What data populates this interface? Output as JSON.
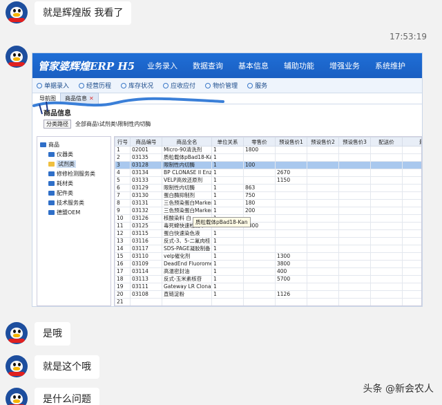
{
  "messages": [
    {
      "text": "就是辉煌版 我看了"
    },
    {
      "text": "是哦"
    },
    {
      "text": "就是这个哦"
    },
    {
      "text": "是什么问题"
    }
  ],
  "timestamp": "17:53:19",
  "erp": {
    "logo": "管家婆辉煌ERP H5",
    "nav": [
      "业务录入",
      "数据查询",
      "基本信息",
      "辅助功能",
      "增强业务",
      "系统维护"
    ],
    "toolbar": [
      "单据录入",
      "经营历程",
      "库存状况",
      "应收应付",
      "物价管理",
      "服务"
    ],
    "tabs": [
      "导航图",
      "商品信息"
    ],
    "page_title": "商品信息",
    "crumb_button": "分类路径",
    "crumb_path": "全部商品\\试剂类\\限制性内切酶",
    "tree": [
      "商品",
      "仪器类",
      "试剂类",
      "修修检测服务类",
      "耗材类",
      "配件类",
      "技术服务类",
      "德盟OEM"
    ],
    "columns": [
      "行号",
      "商品编号",
      "商品全名",
      "单位关系",
      "零售价",
      "预设售价1",
      "预设售价2",
      "预设售价3",
      "配送价",
      "最近"
    ],
    "rows": [
      [
        "1",
        "02001",
        "Micro-90清洗剂",
        "1",
        "1800",
        "",
        ""
      ],
      [
        "2",
        "03135",
        "质粒载体pBad18-Kan",
        "1",
        "",
        "",
        ""
      ],
      [
        "3",
        "03128",
        "限制性内切酶",
        "1",
        "100",
        "",
        ""
      ],
      [
        "4",
        "03134",
        "BP CLONASE II Enz",
        "1",
        "",
        "2670",
        ""
      ],
      [
        "5",
        "03133",
        "VELP高效还原剂",
        "1",
        "",
        "1150",
        ""
      ],
      [
        "6",
        "03129",
        "限制性内切酶",
        "1",
        "863",
        "",
        ""
      ],
      [
        "7",
        "03130",
        "蛋白酶抑制剂",
        "1",
        "750",
        "",
        ""
      ],
      [
        "8",
        "03131",
        "三色预染蛋白Marker",
        "1",
        "180",
        "",
        ""
      ],
      [
        "9",
        "03132",
        "三色预染蛋白Marker",
        "1",
        "200",
        "",
        ""
      ],
      [
        "10",
        "03126",
        "核酸染料  白",
        "1",
        "",
        "",
        ""
      ],
      [
        "11",
        "03125",
        "毒死蜱快速检测卡",
        "1",
        "1800",
        "",
        ""
      ],
      [
        "12",
        "03115",
        "蛋白快速染色液",
        "1",
        "",
        "",
        ""
      ],
      [
        "13",
        "03116",
        "反式-3、5-二氟肉桂",
        "1",
        "",
        "",
        ""
      ],
      [
        "14",
        "03117",
        "SDS-PAGE凝胶制备",
        "1",
        "",
        "",
        ""
      ],
      [
        "15",
        "03110",
        "velp催化剂",
        "1",
        "",
        "1300",
        ""
      ],
      [
        "16",
        "03109",
        "DeadEnd Fluorome",
        "1",
        "",
        "3800",
        ""
      ],
      [
        "17",
        "03114",
        "高温密封油",
        "1",
        "",
        "400",
        ""
      ],
      [
        "18",
        "03113",
        "反式-玉米素核苷",
        "1",
        "",
        "5700",
        ""
      ],
      [
        "19",
        "03111",
        "Gateway LR Clonase",
        "1",
        "",
        "",
        ""
      ],
      [
        "20",
        "03108",
        "直链淀粉",
        "1",
        "",
        "1126",
        ""
      ],
      [
        "21",
        "",
        "",
        "",
        "",
        "",
        ""
      ]
    ],
    "tooltip": "质粒载体pBad18-Kan"
  },
  "watermark": "头条 @新会农人"
}
